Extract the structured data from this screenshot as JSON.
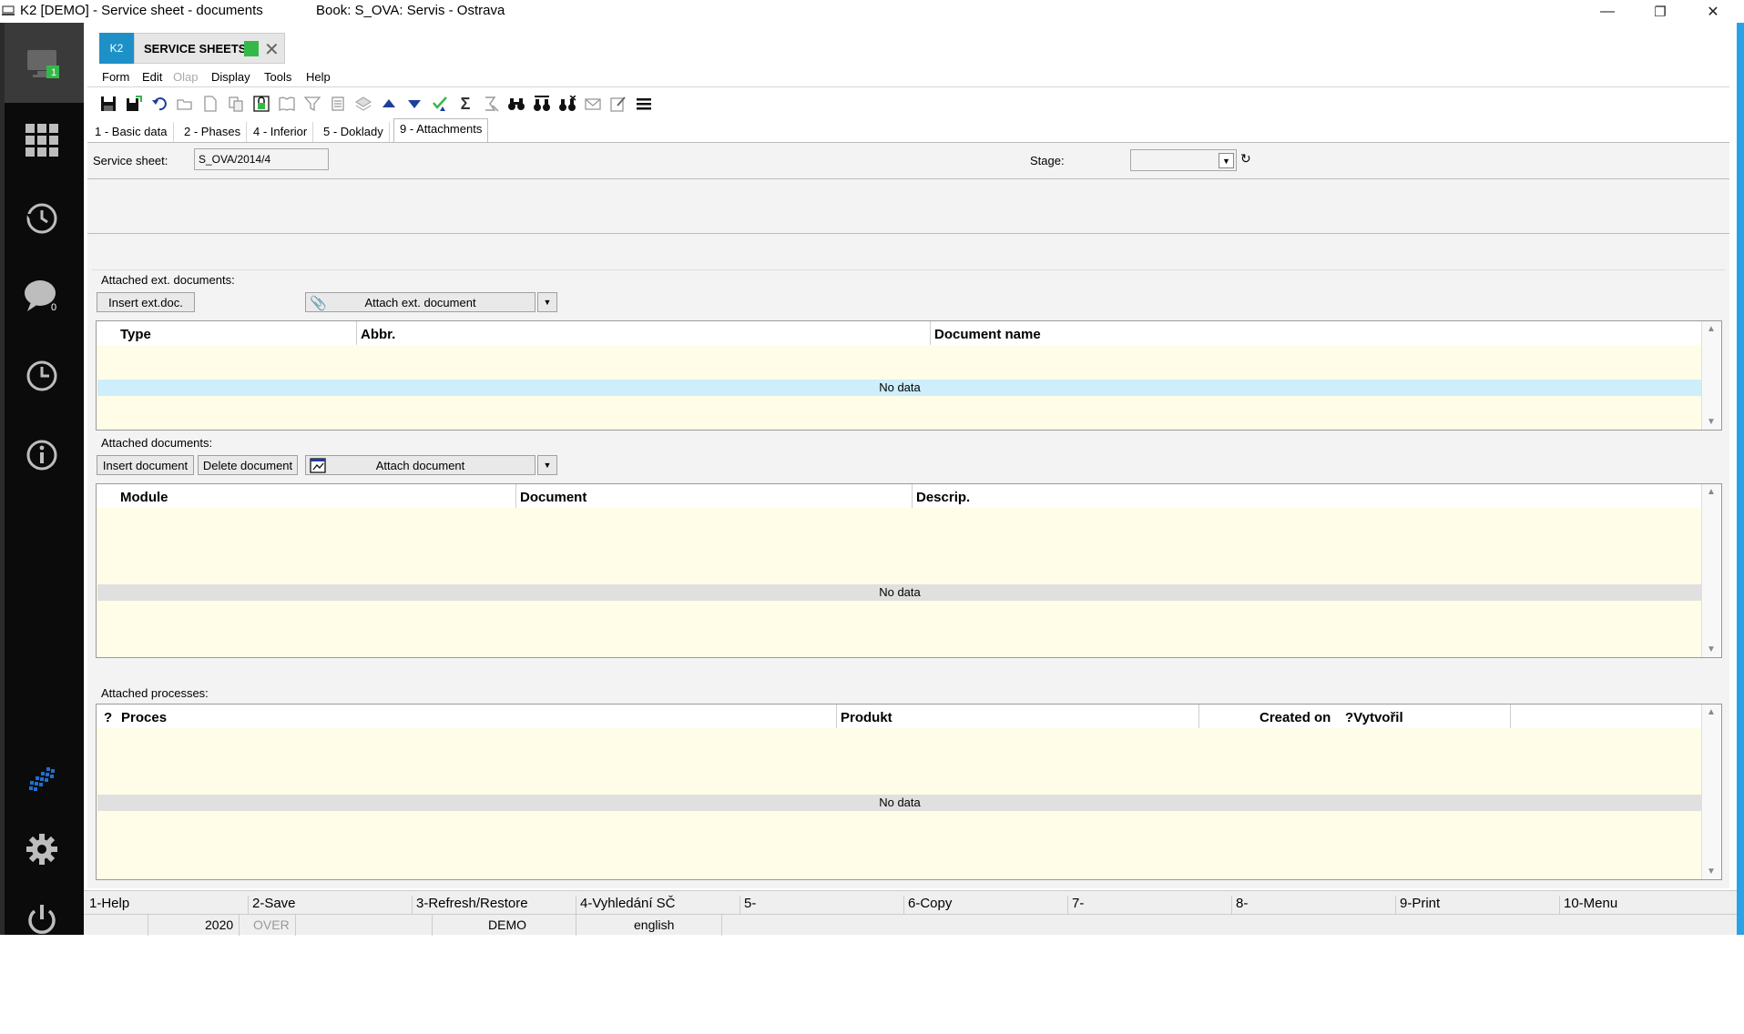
{
  "window": {
    "title": "K2 [DEMO] - Service sheet - documents",
    "book": "Book: S_OVA: Servis - Ostrava",
    "minimize": "—",
    "restore": "❐",
    "close": "✕"
  },
  "sidebar": {
    "monitor_badge": "1",
    "chat_badge": "0"
  },
  "tab": {
    "k2": "K2",
    "label": "SERVICE SHEETS",
    "close": "✕"
  },
  "menu": [
    "Form",
    "Edit",
    "Olap",
    "Display",
    "Tools",
    "Help"
  ],
  "form_tabs": [
    "1 - Basic data",
    "2 - Phases",
    "4 - Inferior",
    "5 - Doklady",
    "9 - Attachments"
  ],
  "header": {
    "service_sheet_label": "Service sheet:",
    "service_sheet_value": "S_OVA/2014/4",
    "stage_label": "Stage:",
    "stage_value": ""
  },
  "ext_docs": {
    "title": "Attached ext. documents:",
    "insert_btn": "Insert ext.doc.",
    "attach_btn": "Attach ext. document",
    "columns": [
      "Type",
      "Abbr.",
      "Document name"
    ],
    "no_data": "No data"
  },
  "docs": {
    "title": "Attached documents:",
    "insert_btn": "Insert document",
    "delete_btn": "Delete document",
    "attach_btn": "Attach document",
    "columns": [
      "Module",
      "Document",
      "Descrip."
    ],
    "no_data": "No data"
  },
  "processes": {
    "title": "Attached processes:",
    "columns": [
      "?",
      "Proces",
      "Produkt",
      "Created on",
      "?Vytvořil"
    ],
    "no_data": "No data"
  },
  "function_keys": [
    "1-Help",
    "2-Save",
    "3-Refresh/Restore",
    "4-Vyhledání SČ",
    "5-",
    "6-Copy",
    "7-",
    "8-",
    "9-Print",
    "10-Menu"
  ],
  "status": {
    "year": "2020",
    "mode": "OVER",
    "db": "DEMO",
    "language": "english"
  },
  "colors": {
    "accent": "#1e90c8",
    "grid_bg": "#fffde8",
    "nodata_blue": "#cdeefa",
    "nodata_gray": "#e0e0e0",
    "sidebar": "#0b0b0b",
    "rightbar": "#29a3e6"
  }
}
